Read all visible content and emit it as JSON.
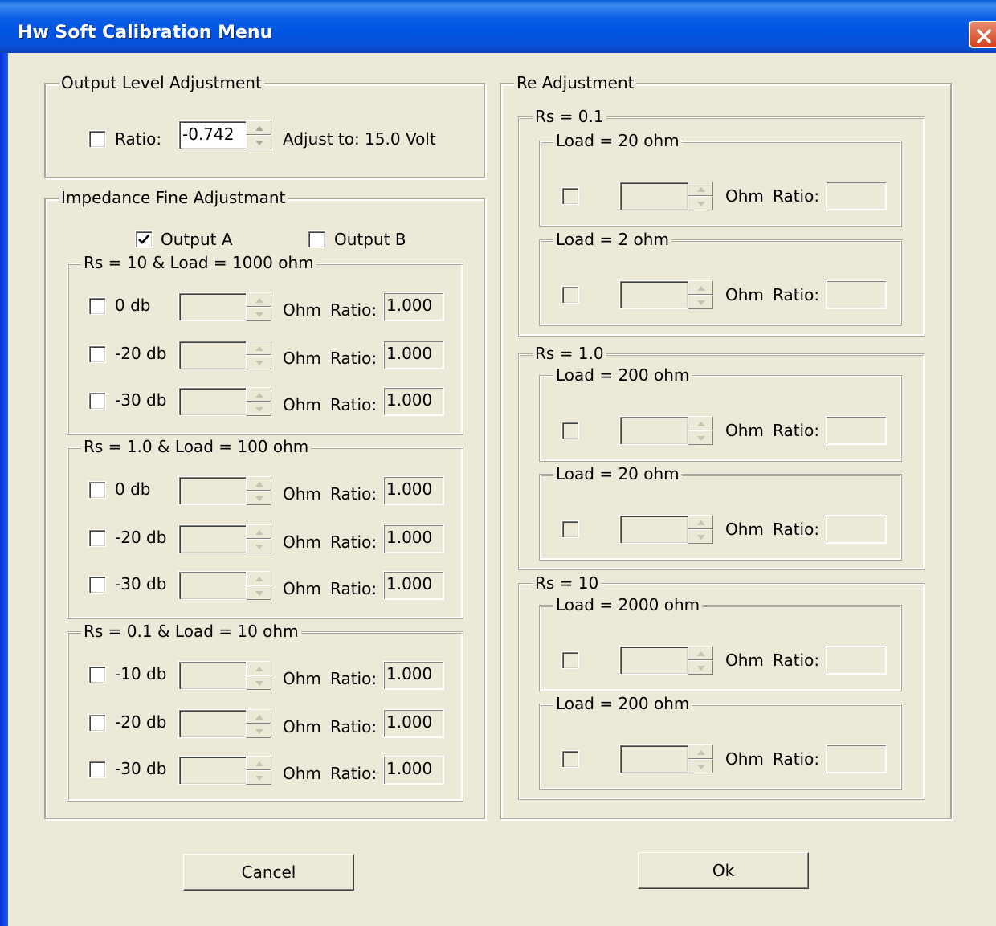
{
  "window": {
    "title": "Hw Soft Calibration Menu",
    "close_label": "X"
  },
  "output_level": {
    "legend": "Output Level Adjustment",
    "ratio_label": "Ratio:",
    "value": "-0.742",
    "adjust_text": "Adjust to:  15.0 Volt"
  },
  "impedance": {
    "legend": "Impedance Fine Adjustmant",
    "output_a": "Output A",
    "output_b": "Output B",
    "output_a_checked": true,
    "output_b_checked": false,
    "groups": [
      {
        "legend": "Rs = 10 & Load = 1000 ohm",
        "rows": [
          {
            "label": "0 db",
            "unit": "Ohm",
            "ratio_label": "Ratio:",
            "ratio": "1.000"
          },
          {
            "label": "-20 db",
            "unit": "Ohm",
            "ratio_label": "Ratio:",
            "ratio": "1.000"
          },
          {
            "label": "-30 db",
            "unit": "Ohm",
            "ratio_label": "Ratio:",
            "ratio": "1.000"
          }
        ]
      },
      {
        "legend": "Rs = 1.0 & Load = 100 ohm",
        "rows": [
          {
            "label": "0 db",
            "unit": "Ohm",
            "ratio_label": "Ratio:",
            "ratio": "1.000"
          },
          {
            "label": "-20 db",
            "unit": "Ohm",
            "ratio_label": "Ratio:",
            "ratio": "1.000"
          },
          {
            "label": "-30 db",
            "unit": "Ohm",
            "ratio_label": "Ratio:",
            "ratio": "1.000"
          }
        ]
      },
      {
        "legend": "Rs = 0.1 & Load = 10 ohm",
        "rows": [
          {
            "label": "-10 db",
            "unit": "Ohm",
            "ratio_label": "Ratio:",
            "ratio": "1.000"
          },
          {
            "label": "-20 db",
            "unit": "Ohm",
            "ratio_label": "Ratio:",
            "ratio": "1.000"
          },
          {
            "label": "-30 db",
            "unit": "Ohm",
            "ratio_label": "Ratio:",
            "ratio": "1.000"
          }
        ]
      }
    ]
  },
  "re_adjustment": {
    "legend": "Re Adjustment",
    "groups": [
      {
        "legend": "Rs = 0.1",
        "loads": [
          {
            "legend": "Load = 20 ohm",
            "unit": "Ohm",
            "ratio_label": "Ratio:"
          },
          {
            "legend": "Load = 2 ohm",
            "unit": "Ohm",
            "ratio_label": "Ratio:"
          }
        ]
      },
      {
        "legend": "Rs = 1.0",
        "loads": [
          {
            "legend": "Load = 200 ohm",
            "unit": "Ohm",
            "ratio_label": "Ratio:"
          },
          {
            "legend": "Load = 20 ohm",
            "unit": "Ohm",
            "ratio_label": "Ratio:"
          }
        ]
      },
      {
        "legend": "Rs = 10",
        "loads": [
          {
            "legend": "Load = 2000 ohm",
            "unit": "Ohm",
            "ratio_label": "Ratio:"
          },
          {
            "legend": "Load = 200 ohm",
            "unit": "Ohm",
            "ratio_label": "Ratio:"
          }
        ]
      }
    ]
  },
  "buttons": {
    "cancel": "Cancel",
    "ok": "Ok"
  }
}
